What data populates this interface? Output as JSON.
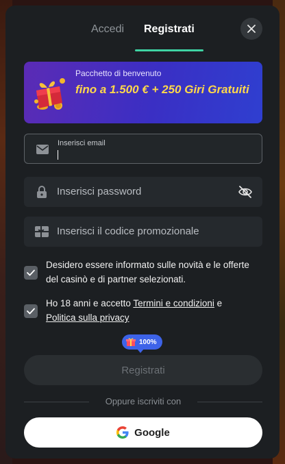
{
  "tabs": {
    "login_label": "Accedi",
    "register_label": "Registrati",
    "active": "Registrati"
  },
  "banner": {
    "subtitle": "Pacchetto di benvenuto",
    "headline": "fino a 1.500 € + 250 Giri Gratuiti"
  },
  "form": {
    "email": {
      "label": "Inserisci email",
      "value": ""
    },
    "password": {
      "placeholder": "Inserisci password",
      "value": ""
    },
    "promo": {
      "placeholder": "Inserisci il codice promozionale",
      "value": ""
    }
  },
  "consents": {
    "marketing_text": "Desidero essere informato sulle novità e le offerte del casinò e di partner selezionati.",
    "marketing_checked": true,
    "terms_prefix": "Ho 18 anni e accetto ",
    "terms_link": "Termini e condizioni",
    "terms_mid": " e",
    "privacy_link": "Politica sulla privacy",
    "terms_checked": true
  },
  "bonus_badge": "100%",
  "submit_label": "Registrati",
  "divider_text": "Oppure iscriviti con",
  "google_label": "Google",
  "colors": {
    "accent": "#3fd3a3",
    "banner_gradient_start": "#5b2bb5",
    "banner_gradient_end": "#2f3fd0",
    "banner_headline": "#ffd84a",
    "badge": "#3d63e8"
  }
}
